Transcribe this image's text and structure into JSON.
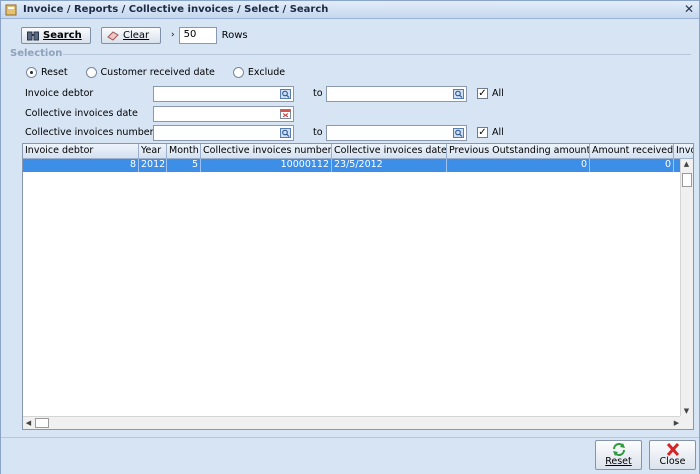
{
  "window": {
    "title": "Invoice / Reports / Collective invoices / Select / Search"
  },
  "toolbar": {
    "search_label": "Search",
    "clear_label": "Clear",
    "rows_value": "50",
    "rows_label": "Rows"
  },
  "selection": {
    "title": "Selection",
    "radios": [
      {
        "label": "Reset",
        "selected": true
      },
      {
        "label": "Customer received date",
        "selected": false
      },
      {
        "label": "Exclude",
        "selected": false
      }
    ],
    "invoice_debtor_label": "Invoice debtor",
    "collective_date_label": "Collective invoices date",
    "collective_number_label": "Collective invoices number",
    "to_label": "to",
    "all_label": "All"
  },
  "grid": {
    "columns": [
      "Invoice debtor",
      "Year",
      "Month",
      "Collective invoices number",
      "Collective invoices date",
      "Previous Outstanding amount",
      "Amount received",
      "Invo"
    ],
    "rows": [
      [
        "8",
        "2012",
        "5",
        "10000112",
        "23/5/2012",
        "0",
        "0",
        ""
      ]
    ]
  },
  "footer": {
    "reset_label": "Reset",
    "close_label": "Close"
  },
  "colors": {
    "selected_row": "#3d8ee6",
    "window_bg": "#d7e4f4"
  }
}
